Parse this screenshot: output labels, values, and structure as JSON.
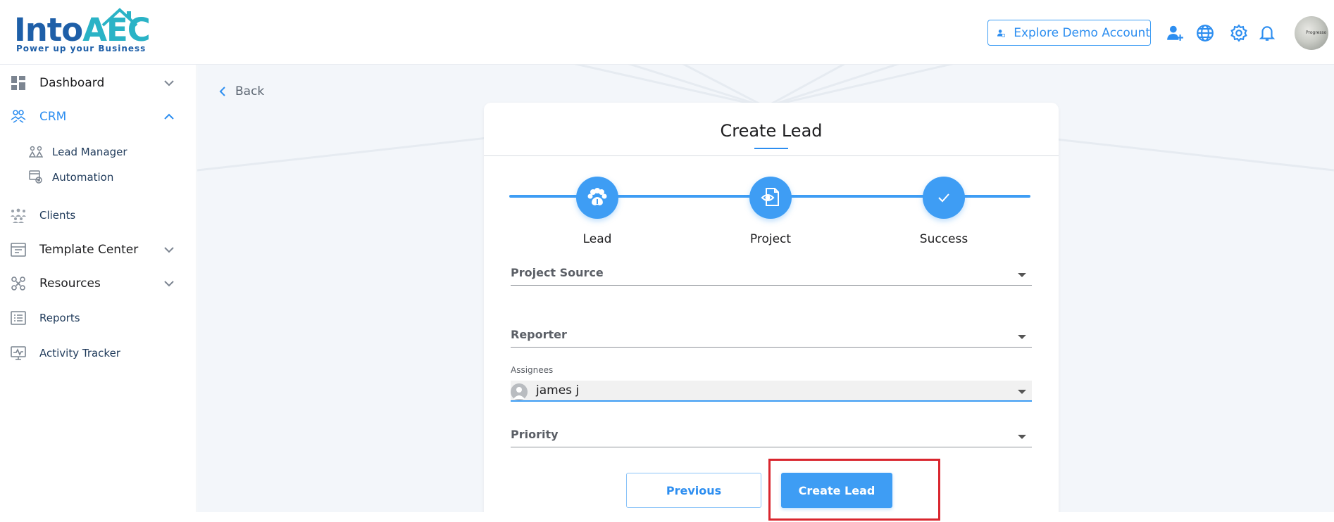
{
  "header": {
    "logo_main": "Into",
    "logo_accent": "AEC",
    "logo_tagline": "Power up your Business",
    "demo_button_label": "Explore Demo Account",
    "avatar_text": "Progresso"
  },
  "sidebar": {
    "items": [
      {
        "label": "Dashboard"
      },
      {
        "label": "CRM"
      },
      {
        "label": "Lead Manager"
      },
      {
        "label": "Automation"
      },
      {
        "label": "Clients"
      },
      {
        "label": "Template Center"
      },
      {
        "label": "Resources"
      },
      {
        "label": "Reports"
      },
      {
        "label": "Activity Tracker"
      }
    ]
  },
  "main": {
    "back_label": "Back",
    "card": {
      "title": "Create Lead",
      "steps": [
        {
          "label": "Lead"
        },
        {
          "label": "Project"
        },
        {
          "label": "Success"
        }
      ],
      "fields": {
        "project_source": {
          "label": "Project Source"
        },
        "reporter": {
          "label": "Reporter"
        },
        "assignees": {
          "caption": "Assignees",
          "value": "james j"
        },
        "priority": {
          "label": "Priority"
        }
      },
      "previous_label": "Previous",
      "create_label": "Create Lead"
    }
  },
  "colors": {
    "accent": "#3e9df4",
    "brand": "#1e5fa8",
    "highlight": "#d9262e"
  }
}
